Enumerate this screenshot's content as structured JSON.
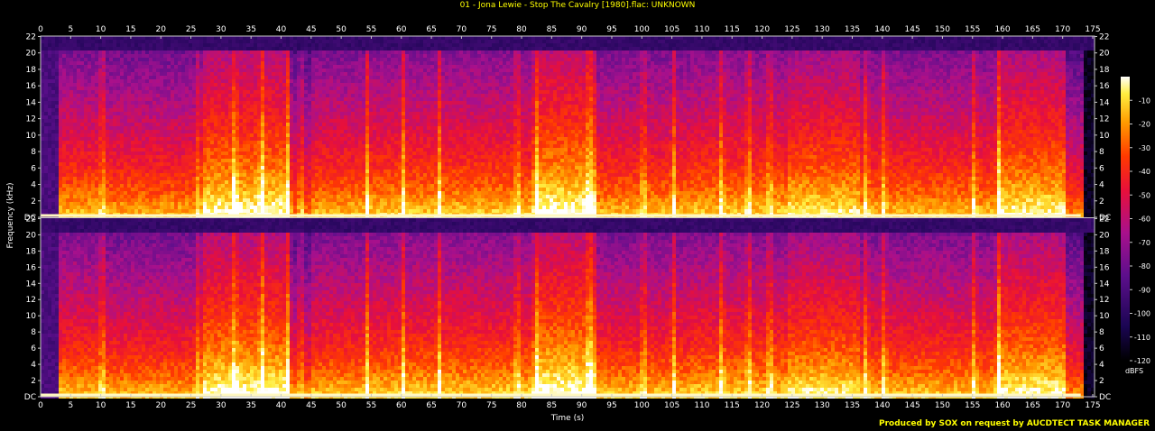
{
  "title": "01 - Jona Lewie - Stop The Cavalry [1980].flac: UNKNOWN",
  "credit": "Produced by SOX on request by AUCDTECT TASK MANAGER",
  "chart_data": {
    "type": "heatmap",
    "xlabel": "Time (s)",
    "ylabel": "Frequency (kHz)",
    "xlim": [
      0,
      175.3
    ],
    "ylim": [
      0,
      22.05
    ],
    "x_ticks": [
      0,
      5,
      10,
      15,
      20,
      25,
      30,
      35,
      40,
      45,
      50,
      55,
      60,
      65,
      70,
      75,
      80,
      85,
      90,
      95,
      100,
      105,
      110,
      115,
      120,
      125,
      130,
      135,
      140,
      145,
      150,
      155,
      160,
      165,
      170,
      175
    ],
    "y_ticks": [
      "DC",
      "2",
      "4",
      "6",
      "8",
      "10",
      "12",
      "14",
      "16",
      "18",
      "20",
      "22"
    ],
    "y_tick_values": [
      0,
      2,
      4,
      6,
      8,
      10,
      12,
      14,
      16,
      18,
      20,
      22
    ],
    "channels": 2,
    "colorbar": {
      "label": "dBFS",
      "ticks": [
        -10,
        -20,
        -30,
        -40,
        -50,
        -60,
        -70,
        -80,
        -90,
        -100,
        -110,
        -120
      ],
      "range": [
        -120,
        0
      ]
    },
    "colors": {
      "background": "#000000",
      "title": "#ffff00",
      "axis": "#c8c8c8",
      "grid_text": "#ffffff"
    },
    "segments": [
      {
        "start": 0,
        "end": 3,
        "level": 0.25
      },
      {
        "start": 3,
        "end": 10,
        "level": 0.7
      },
      {
        "start": 10,
        "end": 27,
        "level": 0.68
      },
      {
        "start": 27,
        "end": 41,
        "level": 0.82
      },
      {
        "start": 41,
        "end": 45,
        "level": 0.62
      },
      {
        "start": 45,
        "end": 54,
        "level": 0.7
      },
      {
        "start": 54,
        "end": 82,
        "level": 0.72
      },
      {
        "start": 82,
        "end": 92,
        "level": 0.84
      },
      {
        "start": 92,
        "end": 108,
        "level": 0.7
      },
      {
        "start": 108,
        "end": 124,
        "level": 0.72
      },
      {
        "start": 124,
        "end": 136,
        "level": 0.78
      },
      {
        "start": 136,
        "end": 159,
        "level": 0.7
      },
      {
        "start": 159,
        "end": 170,
        "level": 0.8
      },
      {
        "start": 170,
        "end": 173,
        "level": 0.62
      },
      {
        "start": 173,
        "end": 175.3,
        "level": 0.05
      }
    ],
    "transients": [
      10,
      26,
      32,
      36.5,
      41,
      43,
      54,
      60,
      66,
      79,
      82,
      91,
      100,
      105,
      113,
      117.5,
      121,
      137,
      140,
      155,
      159
    ]
  }
}
